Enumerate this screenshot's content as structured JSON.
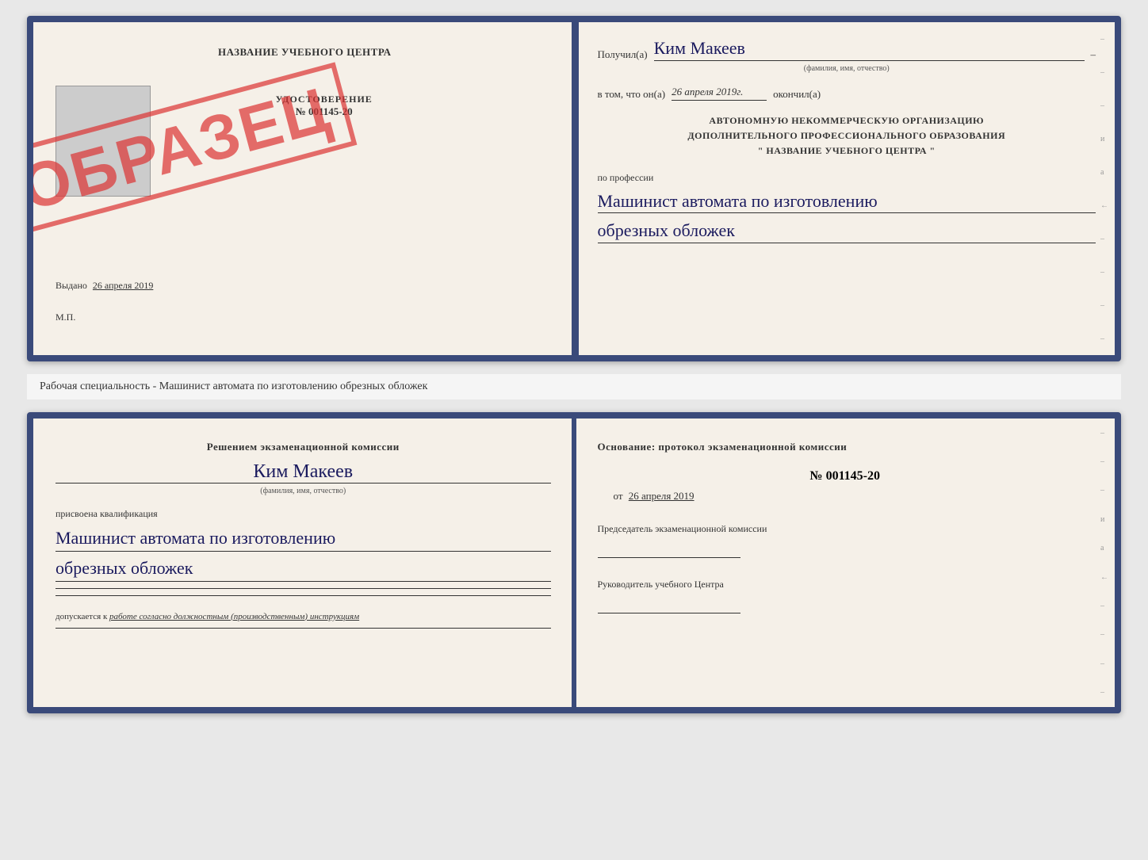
{
  "top_document": {
    "left": {
      "title": "НАЗВАНИЕ УЧЕБНОГО ЦЕНТРА",
      "stamp_text": "ОБРАЗЕЦ",
      "udostoverenie_label": "УДОСТОВЕРЕНИЕ",
      "number": "№ 001145-20",
      "vydano_label": "Выдано",
      "vydano_date": "26 апреля 2019",
      "mp_label": "М.П."
    },
    "right": {
      "poluchil_label": "Получил(а)",
      "recipient_name": "Ким Макеев",
      "fio_hint": "(фамилия, имя, отчество)",
      "vtom_label": "в том, что он(а)",
      "vtom_date": "26 апреля 2019г.",
      "okonchil_label": "окончил(а)",
      "org_line1": "АВТОНОМНУЮ НЕКОММЕРЧЕСКУЮ ОРГАНИЗАЦИЮ",
      "org_line2": "ДОПОЛНИТЕЛЬНОГО ПРОФЕССИОНАЛЬНОГО ОБРАЗОВАНИЯ",
      "org_line3": "\"   НАЗВАНИЕ УЧЕБНОГО ЦЕНТРА   \"",
      "po_professii_label": "по профессии",
      "profession_line1": "Машинист автомата по изготовлению",
      "profession_line2": "обрезных обложек"
    }
  },
  "caption": {
    "text": "Рабочая специальность - Машинист автомата по изготовлению обрезных обложек"
  },
  "bottom_document": {
    "left": {
      "resheniem_label": "Решением экзаменационной комиссии",
      "name": "Ким Макеев",
      "fio_hint": "(фамилия, имя, отчество)",
      "prisvoena_label": "присвоена квалификация",
      "profession_line1": "Машинист автомата по изготовлению",
      "profession_line2": "обрезных обложек",
      "dopuskaetsya_label": "допускается к",
      "dopusk_text": "работе согласно должностным (производственным) инструкциям"
    },
    "right": {
      "osnovanie_label": "Основание: протокол экзаменационной комиссии",
      "protocol_number": "№  001145-20",
      "ot_label": "от",
      "ot_date": "26 апреля 2019",
      "predsedatel_label": "Председатель экзаменационной комиссии",
      "rukovoditel_label": "Руководитель учебного Центра"
    }
  },
  "side_chars": [
    "–",
    "–",
    "–",
    "и",
    "а",
    "←",
    "–",
    "–",
    "–",
    "–"
  ]
}
